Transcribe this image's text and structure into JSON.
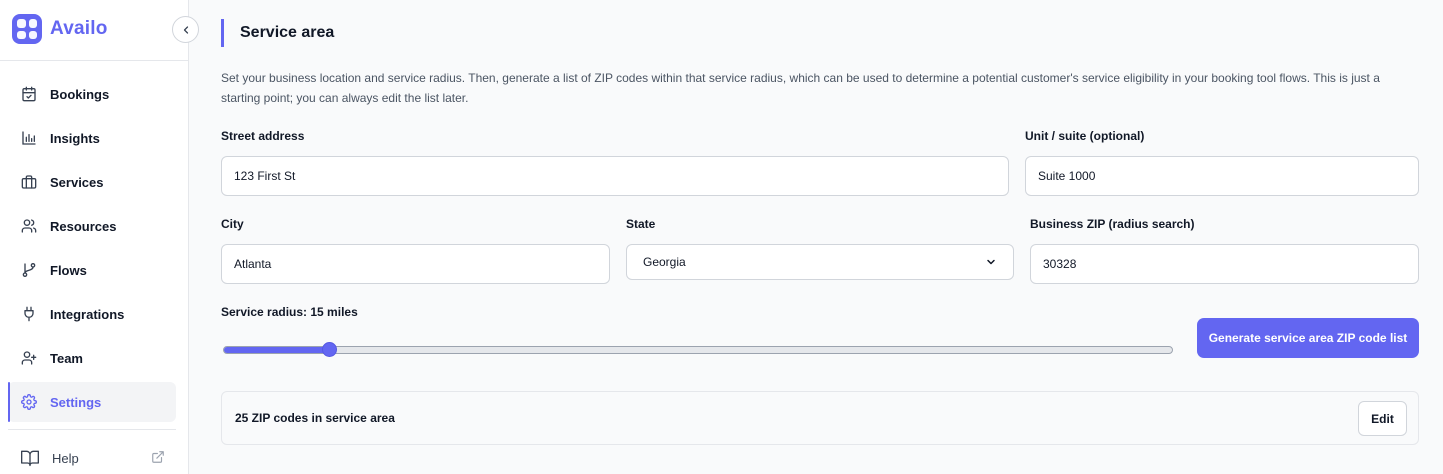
{
  "app": {
    "name": "Availo",
    "accent_color": "#6366f1"
  },
  "sidebar": {
    "collapse_icon": "chevron-left-icon",
    "items": [
      {
        "label": "Bookings",
        "icon": "calendar-check-icon",
        "active": false
      },
      {
        "label": "Insights",
        "icon": "bar-chart-icon",
        "active": false
      },
      {
        "label": "Services",
        "icon": "briefcase-icon",
        "active": false
      },
      {
        "label": "Resources",
        "icon": "users-icon",
        "active": false
      },
      {
        "label": "Flows",
        "icon": "git-branch-icon",
        "active": false
      },
      {
        "label": "Integrations",
        "icon": "plug-icon",
        "active": false
      },
      {
        "label": "Team",
        "icon": "user-plus-icon",
        "active": false
      },
      {
        "label": "Settings",
        "icon": "gear-icon",
        "active": true
      }
    ],
    "help": {
      "label": "Help",
      "icon": "book-open-icon",
      "external_icon": "external-link-icon"
    }
  },
  "main": {
    "title": "Service area",
    "description": "Set your business location and service radius. Then, generate a list of ZIP codes within that service radius, which can be used to determine a potential customer's service eligibility in your booking tool flows. This is just a starting point; you can always edit the list later.",
    "form": {
      "street": {
        "label": "Street address",
        "value": "123 First St"
      },
      "unit": {
        "label": "Unit / suite (optional)",
        "value": "Suite 1000"
      },
      "city": {
        "label": "City",
        "value": "Atlanta"
      },
      "state": {
        "label": "State",
        "value": "Georgia"
      },
      "zip": {
        "label": "Business ZIP (radius search)",
        "value": "30328"
      },
      "radius": {
        "label": "Service radius: 15 miles",
        "value": 15,
        "fraction": 0.112
      }
    },
    "generate_button": "Generate service area ZIP code list",
    "zip_summary": {
      "text": "25 ZIP codes in service area",
      "edit_label": "Edit"
    }
  }
}
